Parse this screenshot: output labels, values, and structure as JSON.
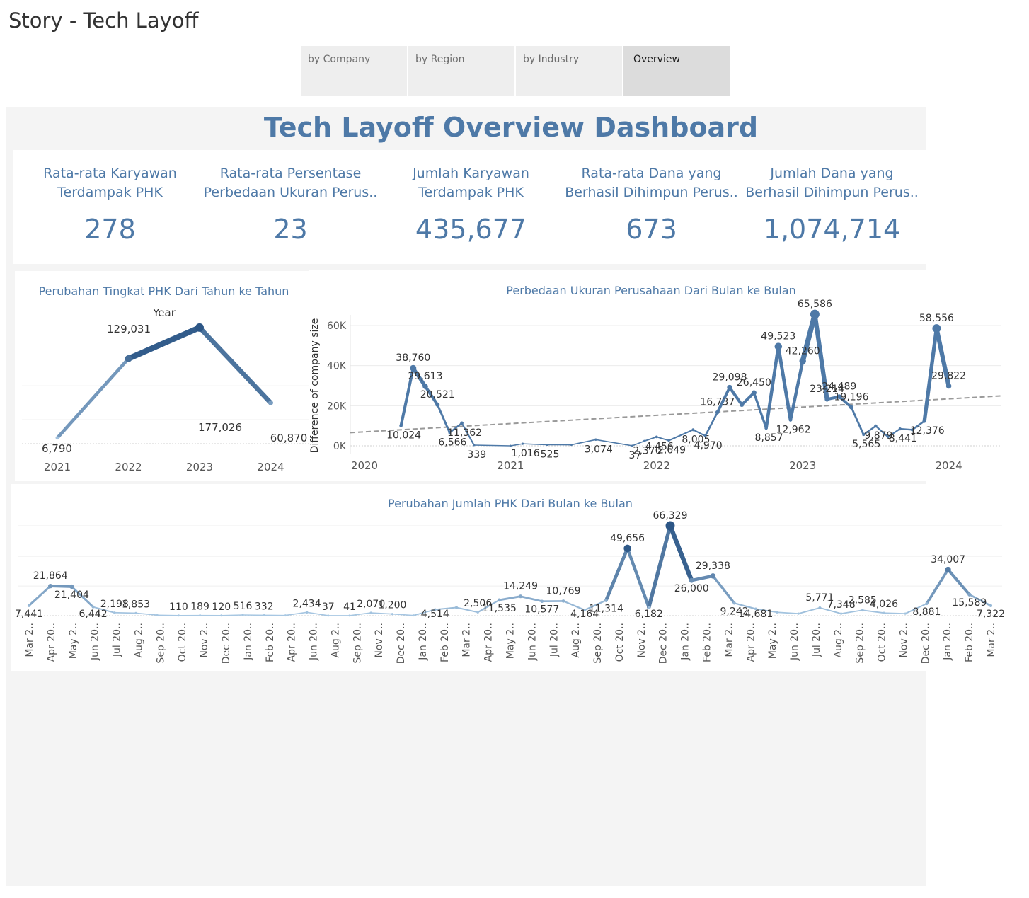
{
  "story": {
    "title": "Story - Tech Layoff",
    "tabs": [
      {
        "label": "by Company",
        "active": false
      },
      {
        "label": "by Region",
        "active": false
      },
      {
        "label": "by Industry",
        "active": false
      },
      {
        "label": "Overview",
        "active": true
      }
    ]
  },
  "dashboard": {
    "title": "Tech Layoff Overview Dashboard",
    "kpis": [
      {
        "label": "Rata-rata Karyawan\nTerdampak PHK",
        "value": "278"
      },
      {
        "label": "Rata-rata Persentase\nPerbedaan Ukuran Perus..",
        "value": "23"
      },
      {
        "label": "Jumlah Karyawan\nTerdampak PHK",
        "value": "435,677"
      },
      {
        "label": "Rata-rata Dana yang\nBerhasil Dihimpun Perus..",
        "value": "673"
      },
      {
        "label": "Jumlah Dana yang\nBerhasil Dihimpun Perus..",
        "value": "1,074,714"
      }
    ]
  },
  "colors": {
    "accent": "#4e79a7",
    "dark": "#2c5686",
    "light": "#a8c8e3",
    "trend": "#999999"
  },
  "chart_data": [
    {
      "type": "line",
      "title": "Perubahan Tingkat PHK Dari Tahun ke Tahun",
      "xlabel": "Year",
      "x": [
        "2021",
        "2022",
        "2023",
        "2024"
      ],
      "values": [
        6790,
        129031,
        177026,
        60870
      ],
      "labels": [
        "6,790",
        "129,031",
        "177,026",
        "60,870"
      ]
    },
    {
      "type": "line",
      "title": "Perbedaan Ukuran Perusahaan Dari Bulan ke Bulan",
      "ylabel": "Difference of company size",
      "yticks": [
        "0K",
        "20K",
        "40K",
        "60K"
      ],
      "ylim": [
        0,
        66000
      ],
      "xticks": [
        "2020",
        "2021",
        "2022",
        "2023",
        "2024"
      ],
      "trendline": true,
      "points": [
        {
          "x": "2020-04",
          "y": 10024,
          "label": "10,024"
        },
        {
          "x": "2020-05",
          "y": 38760,
          "label": "38,760"
        },
        {
          "x": "2020-06",
          "y": 29613,
          "label": "29,613"
        },
        {
          "x": "2020-07",
          "y": 20521,
          "label": "20,521"
        },
        {
          "x": "2020-08",
          "y": 6566,
          "label": "6,566"
        },
        {
          "x": "2020-09",
          "y": 11362,
          "label": "11,362"
        },
        {
          "x": "2020-10",
          "y": 339,
          "label": "339"
        },
        {
          "x": "2021-01",
          "y": 0
        },
        {
          "x": "2021-02",
          "y": 1016,
          "label": "1,016"
        },
        {
          "x": "2021-04",
          "y": 525,
          "label": "525"
        },
        {
          "x": "2021-06",
          "y": 500
        },
        {
          "x": "2021-08",
          "y": 3074,
          "label": "3,074"
        },
        {
          "x": "2021-11",
          "y": 37,
          "label": "37"
        },
        {
          "x": "2021-12",
          "y": 2370,
          "label": "2,370"
        },
        {
          "x": "2022-01",
          "y": 4456,
          "label": "4,456"
        },
        {
          "x": "2022-02",
          "y": 2649,
          "label": "2,649"
        },
        {
          "x": "2022-04",
          "y": 8005,
          "label": "8,005"
        },
        {
          "x": "2022-05",
          "y": 4970,
          "label": "4,970"
        },
        {
          "x": "2022-06",
          "y": 16737,
          "label": "16,737"
        },
        {
          "x": "2022-07",
          "y": 29098,
          "label": "29,098"
        },
        {
          "x": "2022-08",
          "y": 20500
        },
        {
          "x": "2022-09",
          "y": 26450,
          "label": "26,450"
        },
        {
          "x": "2022-10",
          "y": 8857,
          "label": "8,857"
        },
        {
          "x": "2022-11",
          "y": 49523,
          "label": "49,523"
        },
        {
          "x": "2022-12",
          "y": 12962,
          "label": "12,962"
        },
        {
          "x": "2023-01",
          "y": 42260,
          "label": "42,260"
        },
        {
          "x": "2023-02",
          "y": 65586,
          "label": "65,586"
        },
        {
          "x": "2023-03",
          "y": 23214,
          "label": "23,214"
        },
        {
          "x": "2023-04",
          "y": 24489,
          "label": "24,489"
        },
        {
          "x": "2023-05",
          "y": 19196,
          "label": "19,196"
        },
        {
          "x": "2023-06",
          "y": 5565,
          "label": "5,565"
        },
        {
          "x": "2023-07",
          "y": 9879,
          "label": "9,879"
        },
        {
          "x": "2023-08",
          "y": 4500
        },
        {
          "x": "2023-09",
          "y": 8441,
          "label": "8,441"
        },
        {
          "x": "2023-10",
          "y": 8000
        },
        {
          "x": "2023-11",
          "y": 12376,
          "label": "12,376"
        },
        {
          "x": "2023-12",
          "y": 58556,
          "label": "58,556"
        },
        {
          "x": "2024-01",
          "y": 29822,
          "label": "29,822"
        }
      ]
    },
    {
      "type": "line",
      "title": "Perubahan Jumlah PHK Dari Bulan ke Bulan",
      "ylim": [
        0,
        67000
      ],
      "categories": [
        "Mar 2..",
        "Apr 20..",
        "May 2..",
        "Jun 20..",
        "Jul 20..",
        "Aug 2..",
        "Sep 20..",
        "Oct 20..",
        "Nov 2..",
        "Dec 20..",
        "Jan 20..",
        "Feb 20..",
        "Apr 20..",
        "Jun 20..",
        "Aug 2..",
        "Sep 20..",
        "Nov 2..",
        "Dec 20..",
        "Jan 20..",
        "Feb 20..",
        "Mar 2..",
        "Apr 20..",
        "May 2..",
        "Jun 20..",
        "Jul 20..",
        "Aug 2..",
        "Sep 20..",
        "Oct 20..",
        "Nov 2..",
        "Dec 20..",
        "Jan 20..",
        "Feb 20..",
        "Mar 2..",
        "Apr 20..",
        "May 2..",
        "Jun 20..",
        "Jul 20..",
        "Aug 2..",
        "Sep 20..",
        "Oct 20..",
        "Nov 2..",
        "Dec 20..",
        "Jan 20..",
        "Feb 20..",
        "Mar 2.."
      ],
      "values": [
        7441,
        21864,
        21404,
        6442,
        2198,
        1853,
        400,
        110,
        189,
        120,
        516,
        332,
        200,
        2434,
        37,
        41,
        2070,
        1200,
        200,
        4514,
        6000,
        2506,
        11535,
        14249,
        10577,
        10769,
        4164,
        11314,
        49656,
        6182,
        66329,
        26000,
        29338,
        9242,
        5000,
        2500,
        1500,
        5771,
        1500,
        4026,
        2000,
        1500,
        8881,
        34007,
        15589,
        7322
      ],
      "labels": [
        "7,441",
        "21,864",
        "21,404",
        "6,442",
        "2,198",
        "1,853",
        "",
        "110",
        "189",
        "120",
        "516",
        "332",
        "",
        "2,434",
        "37",
        "41",
        "2,070",
        "1,200",
        "",
        "4,514",
        "",
        "2,506",
        "11,535",
        "14,249",
        "10,577",
        "10,769",
        "4,164",
        "11,314",
        "49,656",
        "6,182",
        "66,329",
        "26,000",
        "29,338",
        "9,242",
        "14,681",
        "",
        "",
        "5,771",
        "7,348",
        "2,585",
        "4,026",
        "",
        "8,881",
        "34,007",
        "15,589",
        "7,322"
      ]
    }
  ]
}
